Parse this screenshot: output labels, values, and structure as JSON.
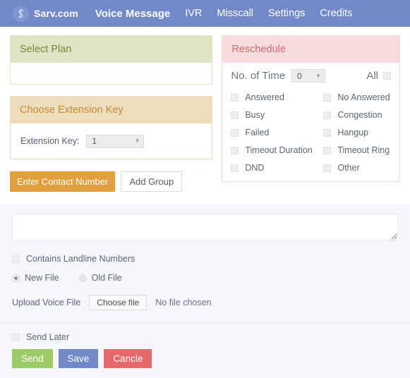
{
  "navbar": {
    "brand": "Sarv.com",
    "logo_icon": "sarv-s-monogram-icon",
    "items": [
      {
        "label": "Voice Message",
        "active": true
      },
      {
        "label": "IVR",
        "active": false
      },
      {
        "label": "Misscall",
        "active": false
      },
      {
        "label": "Settings",
        "active": false
      },
      {
        "label": "Credits",
        "active": false
      }
    ]
  },
  "select_plan": {
    "title": "Select Plan"
  },
  "extension_key": {
    "title": "Choose Extension Key",
    "label": "Extension Key:",
    "value": "1",
    "caret_icon": "chevron-down-icon"
  },
  "contact_actions": {
    "enter_contact_number": "Enter Contact Number",
    "add_group": "Add Group"
  },
  "reschedule": {
    "title": "Reschedule",
    "no_of_time_label": "No. of Time",
    "no_of_time_value": "0",
    "all_label": "All",
    "caret_icon": "chevron-down-icon",
    "options": [
      {
        "label": "Answered",
        "checked": false
      },
      {
        "label": "No Answered",
        "checked": false
      },
      {
        "label": "Busy",
        "checked": false
      },
      {
        "label": "Congestion",
        "checked": false
      },
      {
        "label": "Failed",
        "checked": false
      },
      {
        "label": "Hangup",
        "checked": false
      },
      {
        "label": "Timeout Duration",
        "checked": false
      },
      {
        "label": "Timeout Ring",
        "checked": false
      },
      {
        "label": "DND",
        "checked": false
      },
      {
        "label": "Other",
        "checked": false
      }
    ]
  },
  "bottom": {
    "numbers_value": "",
    "numbers_placeholder": "",
    "contains_landline_label": "Contains Landline Numbers",
    "new_file_label": "New File",
    "old_file_label": "Old File",
    "file_source_selected": "New File",
    "upload_label": "Upload Voice File",
    "choose_file_label": "Choose file",
    "no_file_label": "No file chosen",
    "send_later_label": "Send Later",
    "buttons": {
      "send": "Send",
      "save": "Save",
      "cancel": "Cancle"
    }
  },
  "colors": {
    "nav_bg": "#7289c9",
    "plan_header": "#dde5c4",
    "plan_text": "#77873a",
    "ext_header": "#eeddbd",
    "ext_text": "#bf8b36",
    "resch_header": "#f6dcdc",
    "resch_text": "#d4686c",
    "contact_btn": "#e0a03e",
    "send_btn": "#9ccc65",
    "save_btn": "#7289c9",
    "cancel_btn": "#e8686a",
    "bottom_card_bg": "#f6f7fd"
  }
}
